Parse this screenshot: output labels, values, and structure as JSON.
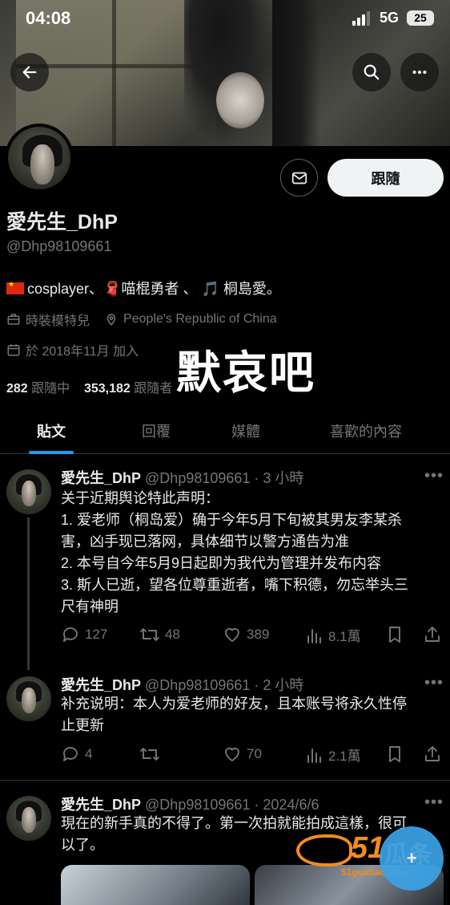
{
  "status_bar": {
    "time": "04:08",
    "network": "5G",
    "battery": "25"
  },
  "profile": {
    "display_name": "愛先生_DhP",
    "handle": "@Dhp98109661",
    "follow_label": "跟隨",
    "bio": {
      "part1": "cosplayer",
      "sep1": "、",
      "emoji2": "🧣",
      "part2": "喵棍勇者",
      "sep2": " 、",
      "emoji3": "🎵",
      "part3": "桐島愛。"
    },
    "category": "時裝模特兒",
    "location": "People's Republic of China",
    "joined": "於 2018年11月 加入",
    "following_count": "282",
    "following_label": "跟隨中",
    "followers_count": "353,182",
    "followers_label": "跟隨者"
  },
  "overlay_caption": "默哀吧",
  "tabs": [
    {
      "label": "貼文",
      "active": true
    },
    {
      "label": "回覆",
      "active": false
    },
    {
      "label": "媒體",
      "active": false
    },
    {
      "label": "喜歡的內容",
      "active": false
    }
  ],
  "tweets": [
    {
      "name": "愛先生_DhP",
      "meta": "@Dhp98109661 · 3 小時",
      "lines": [
        "关于近期舆论特此声明：",
        "1. 爱老师（桐岛爱）确于今年5月下旬被其男友李某杀",
        "害，凶手现已落网，具体细节以警方通告为准",
        "2. 本号自今年5月9日起即为我代为管理并发布内容",
        "3. 斯人已逝，望各位尊重逝者，嘴下积德，勿忘举头三",
        "尺有神明"
      ],
      "replies": "127",
      "retweets": "48",
      "likes": "389",
      "views": "8.1萬"
    },
    {
      "name": "愛先生_DhP",
      "meta": "@Dhp98109661 · 2 小時",
      "lines": [
        "补充说明：本人为爱老师的好友，且本账号将永久性停",
        "止更新"
      ],
      "replies": "4",
      "retweets": "",
      "likes": "70",
      "views": "2.1萬"
    },
    {
      "name": "愛先生_DhP",
      "meta": "@Dhp98109661 · 2024/6/6",
      "lines": [
        "現在的新手真的不得了。第一次拍就能拍成這樣，很可",
        "以了。"
      ]
    }
  ],
  "watermark": {
    "number": "51",
    "text": "瓜条",
    "url": "51guatiao.com"
  },
  "fab_label": "+"
}
